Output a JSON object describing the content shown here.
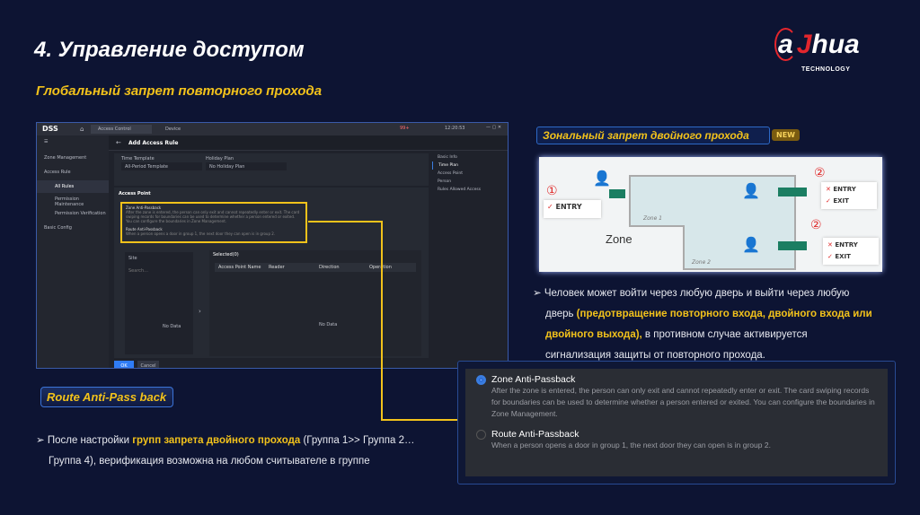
{
  "slide": {
    "title": "4. Управление доступом",
    "subtitle": "Глобальный запрет повторного прохода",
    "logo_text": "alhua",
    "logo_sub": "TECHNOLOGY"
  },
  "app": {
    "brand": "DSS",
    "tabs": [
      "Access Control",
      "Device"
    ],
    "status_badge": "99+",
    "clock": "12:20:53",
    "sidebar": [
      {
        "label": "Zone Management"
      },
      {
        "label": "Access Rule"
      },
      {
        "label": "All Rules"
      },
      {
        "label": "Permission Maintenance"
      },
      {
        "label": "Permission Verification"
      },
      {
        "label": "Basic Config"
      }
    ],
    "page_title": "Add Access Rule",
    "time_template_label": "Time Template",
    "time_template_value": "All-Period Template",
    "holiday_plan_label": "Holiday Plan",
    "holiday_plan_value": "No Holiday Plan",
    "section": "Access Point",
    "option1": "Zone Anti-Passback",
    "option1_desc": "After the zone is entered, the person can only exit and cannot repeatedly enter or exit. The card swiping records for boundaries can be used to determine whether a person entered or exited. You can configure the boundaries in Zone Management.",
    "option2": "Route Anti-Passback",
    "option2_desc": "When a person opens a door in group 1, the next door they can open is in group 2.",
    "site": "Site",
    "search_placeholder": "Search...",
    "no_data": "No Data",
    "selected": "Selected(0)",
    "columns": [
      "Access Point Name",
      "Reader",
      "Direction",
      "Operation"
    ],
    "ok": "OK",
    "cancel": "Cancel",
    "anchors": [
      "Basic Info",
      "Time Plan",
      "Access Point",
      "Person",
      "Rules Allowed Access"
    ]
  },
  "right": {
    "header": "Зональный запрет двойного прохода",
    "badge": "NEW",
    "diagram": {
      "step1": "①",
      "step2": "②",
      "entry": "ENTRY",
      "exit": "EXIT",
      "zone": "Zone",
      "zone1": "Zone 1",
      "zone2": "Zone 2"
    },
    "bullet_a": "Человек может войти через любую дверь и выйти через любую дверь ",
    "bullet_b": "(предотвращение повторного входа, двойного входа или двойного выхода),",
    "bullet_c": " в противном случае активируется сигнализация защиты от повторного прохода."
  },
  "left": {
    "route_button": "Route Anti-Pass back",
    "bullet_a": "После настройки ",
    "bullet_b": "групп запрета двойного прохода",
    "bullet_c": " (Группа 1>> Группа 2… Группа 4), верификация возможна на любом считывателе в группе"
  }
}
